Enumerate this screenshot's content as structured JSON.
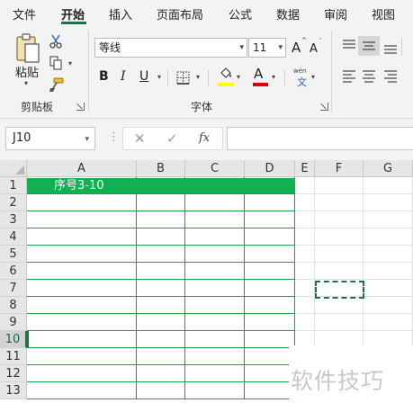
{
  "ribbon_tabs": [
    {
      "label": "文件",
      "active": false
    },
    {
      "label": "开始",
      "active": true
    },
    {
      "label": "插入",
      "active": false
    },
    {
      "label": "页面布局",
      "active": false
    },
    {
      "label": "公式",
      "active": false
    },
    {
      "label": "数据",
      "active": false
    },
    {
      "label": "审阅",
      "active": false
    },
    {
      "label": "视图",
      "active": false
    }
  ],
  "clipboard": {
    "paste_label": "粘贴",
    "group_label": "剪贴板",
    "icons": [
      "paste-icon",
      "cut-icon",
      "copy-icon",
      "format-painter-icon"
    ]
  },
  "font": {
    "group_label": "字体",
    "font_name": "等线",
    "font_size": "11",
    "bold": "B",
    "italic": "I",
    "underline": "U",
    "font_color": "A",
    "grow_font": "A",
    "shrink_font": "A",
    "phonetic_top": "wén",
    "phonetic_bottom": "文",
    "fill_color_accent": "#ffff00",
    "font_color_accent": "#e00000"
  },
  "formula_bar": {
    "name_box": "J10",
    "cancel_symbol": "✕",
    "enter_symbol": "✓",
    "fx_label": "fx",
    "formula": ""
  },
  "sheet": {
    "columns": [
      "A",
      "B",
      "C",
      "D",
      "E",
      "F",
      "G"
    ],
    "rows": [
      "1",
      "2",
      "3",
      "4",
      "5",
      "6",
      "7",
      "8",
      "9",
      "10",
      "11",
      "12",
      "13"
    ],
    "active_row": "10",
    "title_text": "序号3-10",
    "accent_color": "#11b050"
  },
  "watermark": "软件技巧"
}
